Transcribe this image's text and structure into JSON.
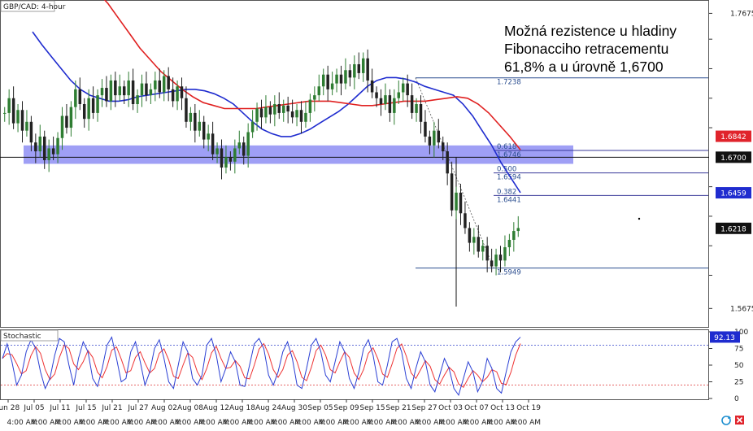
{
  "chart": {
    "symbol_label": "GBP/CAD: 4-hour",
    "annotation_lines": [
      "Možná rezistence u hladiny",
      "Fibonacciho retracementu",
      "61,8% a u úrovně 1,6700"
    ],
    "colors": {
      "up_candle": "#2e7d32",
      "down_candle": "#222222",
      "sma_fast": "#1f2ccf",
      "sma_slow": "#e02020",
      "support_zone": "#7f7ff2",
      "fib_line": "#3a3a9a",
      "stoch_k": "#2a3fd4",
      "stoch_d": "#e33",
      "price_tag_red": "#e0242c",
      "price_tag_blue": "#1f2ccf",
      "price_tag_black": "#111111"
    }
  },
  "chart_data": {
    "type": "line",
    "title": "",
    "subtitle": "GBP/CAD: 4-hour",
    "xlabel": "",
    "ylabel": "",
    "ylim": [
      1.555,
      1.776
    ],
    "y_ticks": [
      "1.7675",
      "1.5675"
    ],
    "x_ticks": [
      "Jun 28",
      "Jul 05",
      "Jul 11",
      "Jul 15",
      "Jul 21",
      "Jul 27",
      "Aug 02",
      "Aug 08",
      "Aug 12",
      "Aug 18",
      "Aug 24",
      "Aug 30",
      "Sep 05",
      "Sep 09",
      "Sep 15",
      "Sep 21",
      "Sep 27",
      "Oct 03",
      "Oct 07",
      "Oct 13",
      "Oct 19"
    ],
    "session_label": "4:00 AM",
    "price_tags": [
      {
        "label": "1.6842",
        "value": 1.6842,
        "style": "red"
      },
      {
        "label": "1.6700",
        "value": 1.67,
        "style": "black"
      },
      {
        "label": "1.6459",
        "value": 1.6459,
        "style": "blue"
      },
      {
        "label": "1.6218",
        "value": 1.6218,
        "style": "black"
      }
    ],
    "fib_levels": [
      {
        "ratio": "",
        "price": "1.7238",
        "value": 1.7238
      },
      {
        "ratio": "0.618",
        "price": "1.6746",
        "value": 1.6746
      },
      {
        "ratio": "0.500",
        "price": "1.6594",
        "value": 1.6594
      },
      {
        "ratio": "0.382",
        "price": "1.6441",
        "value": 1.6441
      },
      {
        "ratio": "",
        "price": "1.5949",
        "value": 1.5949
      }
    ],
    "horizontal_line": 1.67,
    "support_zone": [
      1.6655,
      1.678
    ],
    "series": [
      {
        "name": "",
        "kind": "close",
        "values": [
          1.7,
          1.71,
          1.693,
          1.702,
          1.688,
          1.694,
          1.68,
          1.674,
          1.684,
          1.668,
          1.676,
          1.672,
          1.683,
          1.698,
          1.69,
          1.704,
          1.716,
          1.706,
          1.696,
          1.71,
          1.7,
          1.712,
          1.717,
          1.708,
          1.722,
          1.712,
          1.718,
          1.712,
          1.722,
          1.706,
          1.712,
          1.72,
          1.712,
          1.716,
          1.722,
          1.714,
          1.725,
          1.716,
          1.708,
          1.718,
          1.71,
          1.694,
          1.7,
          1.688,
          1.694,
          1.682,
          1.686,
          1.672,
          1.676,
          1.663,
          1.67,
          1.667,
          1.676,
          1.68,
          1.671,
          1.687,
          1.694,
          1.703,
          1.697,
          1.704,
          1.699,
          1.706,
          1.7,
          1.705,
          1.701,
          1.697,
          1.702,
          1.694,
          1.7,
          1.709,
          1.712,
          1.718,
          1.726,
          1.716,
          1.72,
          1.726,
          1.72,
          1.729,
          1.724,
          1.733,
          1.727,
          1.737,
          1.722,
          1.714,
          1.71,
          1.706,
          1.712,
          1.7,
          1.71,
          1.714,
          1.72,
          1.712,
          1.7,
          1.706,
          1.694,
          1.684,
          1.678,
          1.688,
          1.68,
          1.674,
          1.659,
          1.634,
          1.646,
          1.632,
          1.622,
          1.612,
          1.616,
          1.606,
          1.61,
          1.6,
          1.596,
          1.604,
          1.6,
          1.609,
          1.614,
          1.62,
          1.622
        ]
      },
      {
        "name": "",
        "kind": "sma_fast",
        "values": [
          1.755,
          1.746,
          1.738,
          1.73,
          1.722,
          1.716,
          1.712,
          1.71,
          1.708,
          1.708,
          1.709,
          1.711,
          1.712,
          1.713,
          1.714,
          1.715,
          1.716,
          1.716,
          1.715,
          1.713,
          1.71,
          1.706,
          1.7,
          1.694,
          1.689,
          1.686,
          1.684,
          1.684,
          1.686,
          1.689,
          1.693,
          1.697,
          1.701,
          1.706,
          1.712,
          1.718,
          1.722,
          1.724,
          1.724,
          1.723,
          1.721,
          1.718,
          1.716,
          1.714,
          1.712,
          1.706,
          1.698,
          1.688,
          1.678,
          1.666,
          1.656,
          1.646
        ]
      },
      {
        "name": "",
        "kind": "sma_slow",
        "values": [
          1.782,
          1.774,
          1.764,
          1.754,
          1.744,
          1.736,
          1.728,
          1.722,
          1.716,
          1.711,
          1.707,
          1.705,
          1.703,
          1.703,
          1.703,
          1.703,
          1.704,
          1.705,
          1.706,
          1.707,
          1.708,
          1.708,
          1.708,
          1.707,
          1.706,
          1.705,
          1.705,
          1.706,
          1.707,
          1.708,
          1.708,
          1.708,
          1.709,
          1.71,
          1.711,
          1.71,
          1.706,
          1.7,
          1.692,
          1.684,
          1.675
        ]
      },
      {
        "name": "Stochastic",
        "kind": "stoch_k",
        "values": [
          60,
          82,
          55,
          20,
          35,
          70,
          88,
          75,
          40,
          15,
          30,
          65,
          90,
          85,
          50,
          20,
          60,
          85,
          70,
          30,
          18,
          45,
          80,
          92,
          60,
          25,
          30,
          70,
          85,
          55,
          20,
          40,
          75,
          88,
          60,
          25,
          15,
          50,
          85,
          70,
          30,
          20,
          35,
          80,
          90,
          65,
          25,
          45,
          70,
          55,
          20,
          18,
          50,
          82,
          90,
          75,
          35,
          20,
          40,
          70,
          85,
          60,
          20,
          15,
          45,
          80,
          90,
          70,
          35,
          25,
          55,
          85,
          70,
          30,
          15,
          40,
          75,
          88,
          65,
          25,
          20,
          50,
          85,
          90,
          70,
          30,
          15,
          45,
          70,
          55,
          20,
          10,
          35,
          60,
          45,
          15,
          5,
          30,
          55,
          40,
          10,
          25,
          60,
          45,
          15,
          8,
          40,
          70,
          85,
          92
        ]
      },
      {
        "name": "",
        "kind": "stoch_d",
        "values": []
      }
    ],
    "stochastic": {
      "label": "Stochastic",
      "current_label": "92.13",
      "current_value": 92.13,
      "ticks": [
        "100",
        "75",
        "50",
        "25",
        "0"
      ],
      "levels": [
        80,
        20
      ]
    }
  }
}
